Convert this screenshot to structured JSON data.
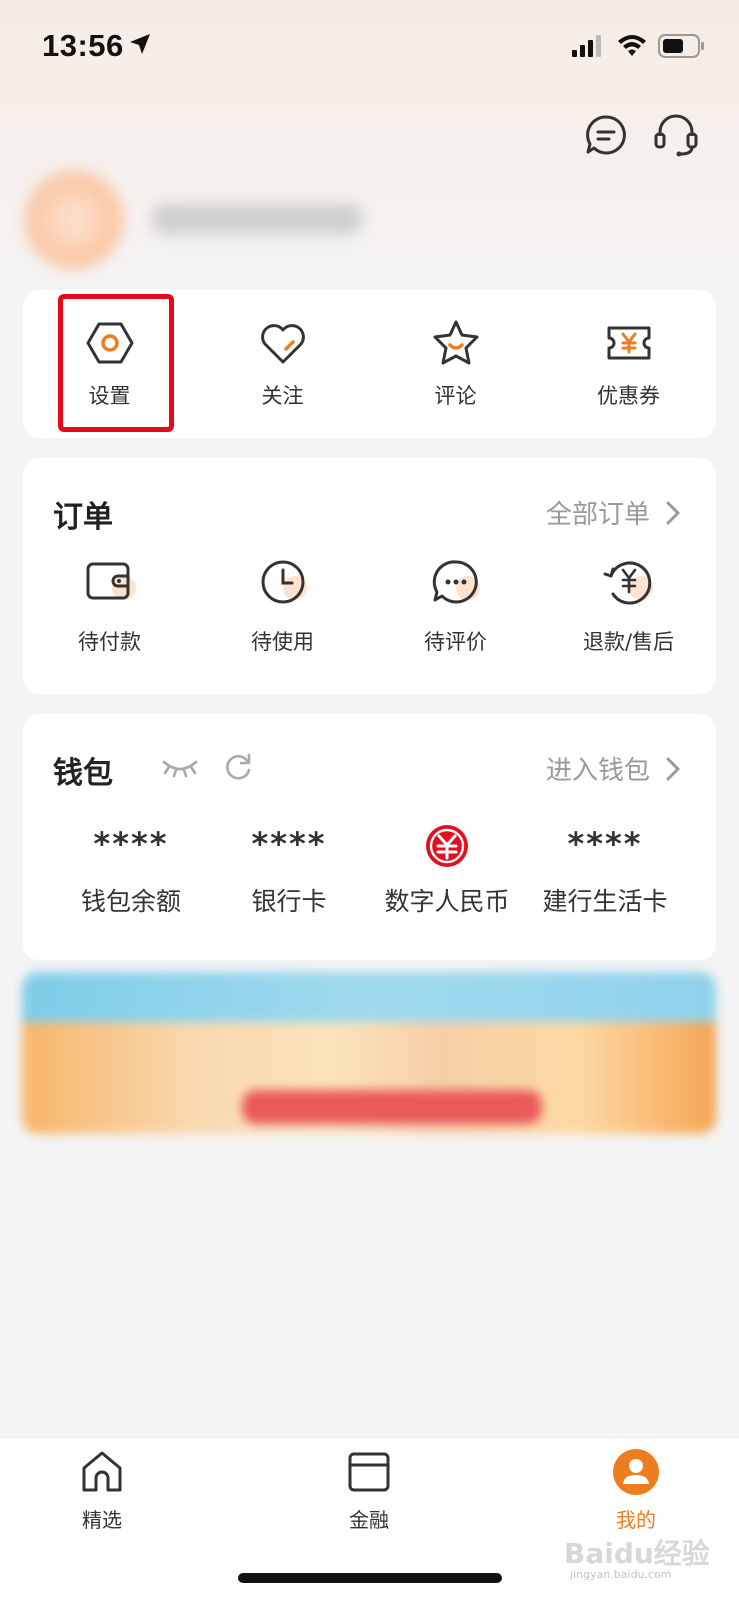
{
  "status_bar": {
    "time": "13:56"
  },
  "quick_actions": [
    {
      "label": "设置",
      "icon": "settings-hexagon-icon"
    },
    {
      "label": "关注",
      "icon": "heart-icon"
    },
    {
      "label": "评论",
      "icon": "star-icon"
    },
    {
      "label": "优惠券",
      "icon": "coupon-icon"
    }
  ],
  "orders": {
    "title": "订单",
    "link": "全部订单",
    "items": [
      {
        "label": "待付款",
        "icon": "wallet-icon"
      },
      {
        "label": "待使用",
        "icon": "clock-icon"
      },
      {
        "label": "待评价",
        "icon": "chat-bubble-icon"
      },
      {
        "label": "退款/售后",
        "icon": "refund-icon"
      }
    ]
  },
  "wallet": {
    "title": "钱包",
    "link": "进入钱包",
    "items": [
      {
        "value": "****",
        "label": "钱包余额"
      },
      {
        "value": "****",
        "label": "银行卡"
      },
      {
        "value": "",
        "label": "数字人民币",
        "icon": "digital-rmb-icon"
      },
      {
        "value": "****",
        "label": "建行生活卡"
      }
    ]
  },
  "tabs": [
    {
      "label": "精选",
      "icon": "home-icon",
      "active": false
    },
    {
      "label": "金融",
      "icon": "card-icon",
      "active": false
    },
    {
      "label": "我的",
      "icon": "user-icon",
      "active": true
    }
  ],
  "colors": {
    "accent": "#ee7d1f",
    "highlight_box": "#e8081c",
    "rmb_red": "#e30f1e"
  },
  "watermark": {
    "text": "Baidu经验",
    "sub": "jingyan.baidu.com"
  }
}
